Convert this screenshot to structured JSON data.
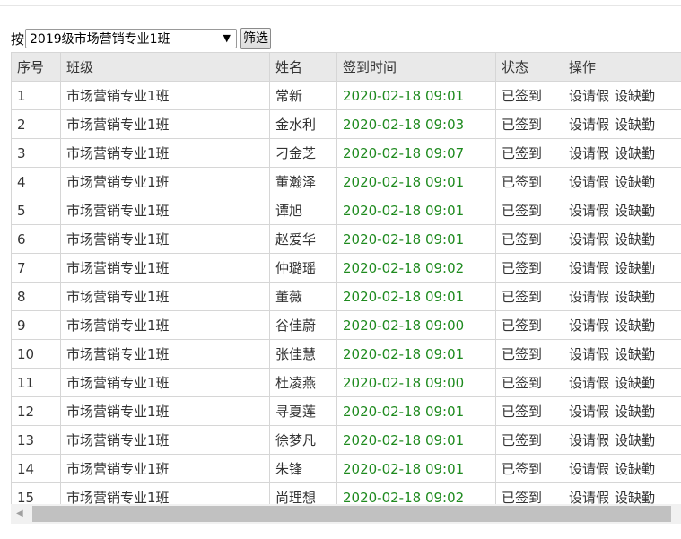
{
  "filter": {
    "label": "按",
    "selected": "2019级市场营销专业1班",
    "button": "筛选"
  },
  "table": {
    "headers": [
      "序号",
      "班级",
      "姓名",
      "签到时间",
      "状态",
      "操作"
    ],
    "rows": [
      {
        "no": "1",
        "class": "市场营销专业1班",
        "name": "常新",
        "time": "2020-02-18 09:01",
        "status": "已签到"
      },
      {
        "no": "2",
        "class": "市场营销专业1班",
        "name": "金水利",
        "time": "2020-02-18 09:03",
        "status": "已签到"
      },
      {
        "no": "3",
        "class": "市场营销专业1班",
        "name": "刁金芝",
        "time": "2020-02-18 09:07",
        "status": "已签到"
      },
      {
        "no": "4",
        "class": "市场营销专业1班",
        "name": "董瀚泽",
        "time": "2020-02-18 09:01",
        "status": "已签到"
      },
      {
        "no": "5",
        "class": "市场营销专业1班",
        "name": "谭旭",
        "time": "2020-02-18 09:01",
        "status": "已签到"
      },
      {
        "no": "6",
        "class": "市场营销专业1班",
        "name": "赵爱华",
        "time": "2020-02-18 09:01",
        "status": "已签到"
      },
      {
        "no": "7",
        "class": "市场营销专业1班",
        "name": "仲璐瑶",
        "time": "2020-02-18 09:02",
        "status": "已签到"
      },
      {
        "no": "8",
        "class": "市场营销专业1班",
        "name": "董薇",
        "time": "2020-02-18 09:01",
        "status": "已签到"
      },
      {
        "no": "9",
        "class": "市场营销专业1班",
        "name": "谷佳蔚",
        "time": "2020-02-18 09:00",
        "status": "已签到"
      },
      {
        "no": "10",
        "class": "市场营销专业1班",
        "name": "张佳慧",
        "time": "2020-02-18 09:01",
        "status": "已签到"
      },
      {
        "no": "11",
        "class": "市场营销专业1班",
        "name": "杜凌燕",
        "time": "2020-02-18 09:00",
        "status": "已签到"
      },
      {
        "no": "12",
        "class": "市场营销专业1班",
        "name": "寻夏莲",
        "time": "2020-02-18 09:01",
        "status": "已签到"
      },
      {
        "no": "13",
        "class": "市场营销专业1班",
        "name": "徐梦凡",
        "time": "2020-02-18 09:01",
        "status": "已签到"
      },
      {
        "no": "14",
        "class": "市场营销专业1班",
        "name": "朱锋",
        "time": "2020-02-18 09:01",
        "status": "已签到"
      },
      {
        "no": "15",
        "class": "市场营销专业1班",
        "name": "尚理想",
        "time": "2020-02-18 09:02",
        "status": "已签到"
      }
    ],
    "actions": {
      "leave": "设请假",
      "absent": "设缺勤"
    }
  },
  "icons": {
    "select_arrow": "triangle-down-icon",
    "scroll_left": "triangle-left-icon"
  },
  "colors": {
    "time_text": "#1e8a1e",
    "header_bg": "#e9e9e9"
  }
}
